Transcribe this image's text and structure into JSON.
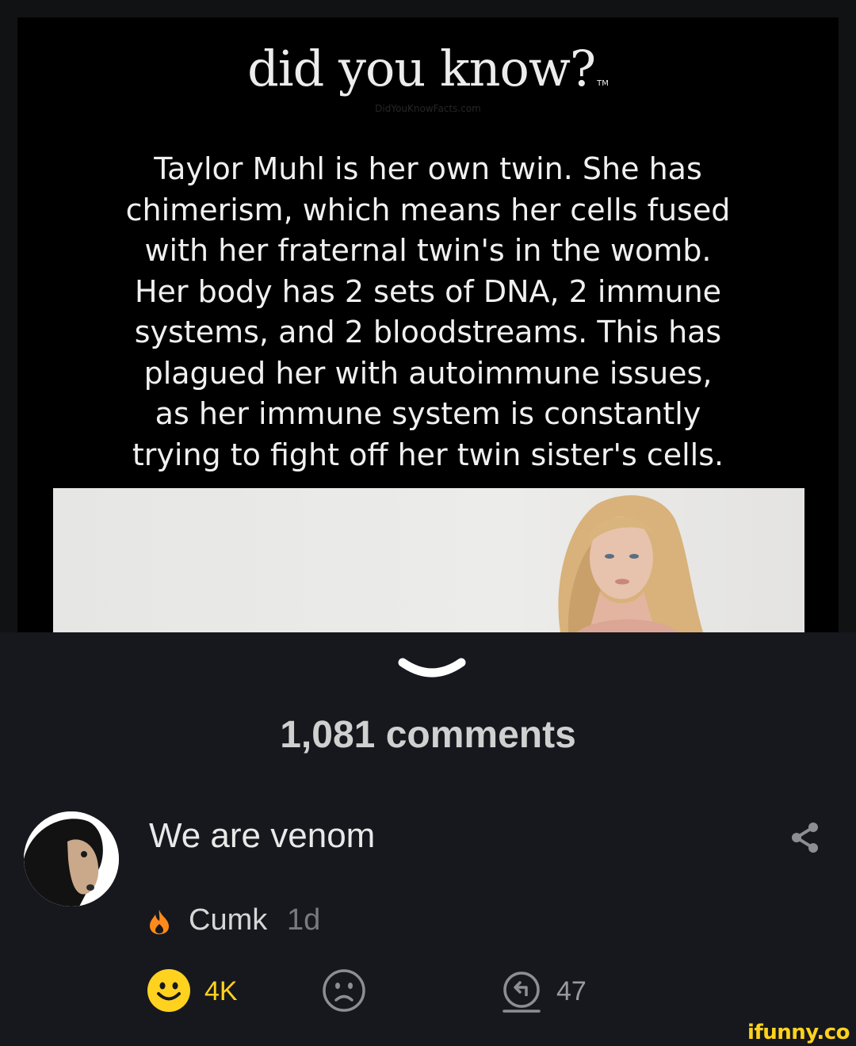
{
  "meme": {
    "title": "did you know?",
    "tm": "TM",
    "watermark": "DidYouKnowFacts.com",
    "body": "Taylor Muhl is her own twin. She has\nchimerism, which means her cells fused\nwith her fraternal twin's in the womb.\nHer body has 2 sets of DNA, 2 immune\nsystems, and 2 bloodstreams. This has\nplagued her with autoimmune issues,\nas her immune system is constantly\ntrying to fight off her twin sister's cells."
  },
  "comments": {
    "count_label": "1,081 comments"
  },
  "comment": {
    "text": "We are venom",
    "username": "Cumk",
    "age": "1d",
    "smile_count": "4K",
    "reply_count": "47"
  },
  "brand": "ifunny.co",
  "colors": {
    "background": "#17181d",
    "accent_yellow": "#ffd21f",
    "fire_orange": "#ff8a1c"
  }
}
